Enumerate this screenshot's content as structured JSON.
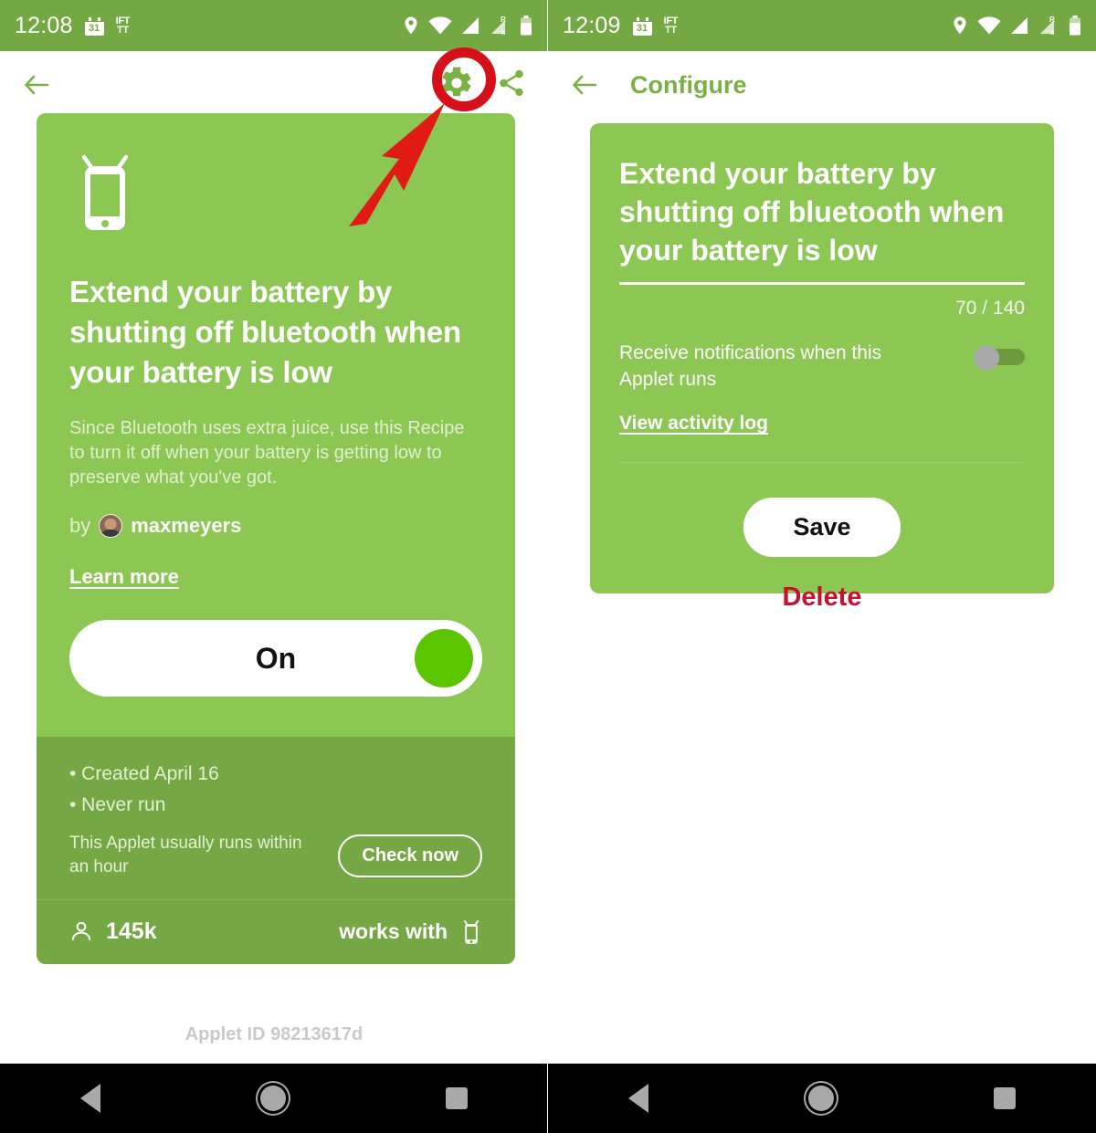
{
  "colors": {
    "status_bar_green": "#74a843",
    "card_green": "#8cc653",
    "card_footer_green": "#75a844",
    "accent_green": "#79b144",
    "toggle_on_green": "#5bc500",
    "annotation_red": "#d5101b",
    "delete_red": "#c8102e"
  },
  "left_screen": {
    "status_bar": {
      "time": "12:08",
      "calendar_day": "31",
      "app_logo": "IFTTT",
      "icons": [
        "location-icon",
        "wifi-icon",
        "signal-icon",
        "roaming-signal-icon",
        "battery-icon"
      ]
    },
    "appbar": {
      "back_icon": "back-arrow-icon",
      "settings_icon": "gear-icon",
      "share_icon": "share-icon"
    },
    "card": {
      "device_icon": "android-device-icon",
      "title": "Extend your battery by shutting off bluetooth when your battery is low",
      "description": "Since Bluetooth uses extra juice, use this Recipe to turn it off when your battery is getting low to preserve what you've got.",
      "by_label": "by",
      "author": "maxmeyers",
      "learn_more": "Learn more",
      "toggle": {
        "label": "On",
        "state": "on"
      },
      "meta": {
        "created": "• Created April 16",
        "never_run": "• Never run",
        "run_frequency": "This Applet usually runs within an hour",
        "check_now": "Check now"
      },
      "footer": {
        "users_icon": "person-icon",
        "users_count": "145k",
        "works_with_label": "works with",
        "works_with_icon": "android-device-icon"
      }
    },
    "applet_id": "Applet ID 98213617d"
  },
  "annotations": {
    "highlight_circle_target": "gear-icon",
    "arrow_points_to": "gear-icon"
  },
  "right_screen": {
    "status_bar": {
      "time": "12:09",
      "calendar_day": "31",
      "app_logo": "IFTTT",
      "icons": [
        "location-icon",
        "wifi-icon",
        "signal-icon",
        "roaming-signal-icon",
        "battery-icon"
      ]
    },
    "appbar": {
      "back_icon": "back-arrow-icon",
      "title": "Configure"
    },
    "card": {
      "title": "Extend your battery by shutting off bluetooth when your battery is low",
      "char_counter": "70 / 140",
      "notifications_label": "Receive notifications when this Applet runs",
      "notifications_state": "off",
      "view_activity_log": "View activity log",
      "save_label": "Save"
    },
    "delete_label": "Delete"
  },
  "navbar": {
    "back": "nav-back-icon",
    "home": "nav-home-icon",
    "recents": "nav-recents-icon"
  }
}
